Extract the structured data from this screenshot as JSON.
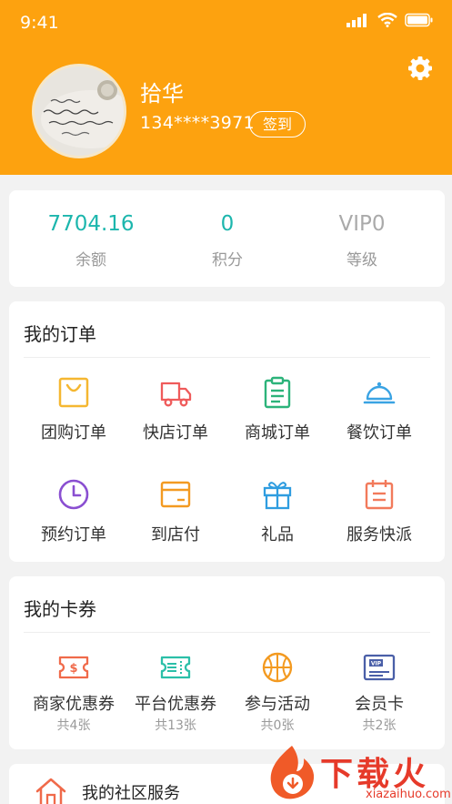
{
  "status_bar": {
    "time": "9:41"
  },
  "profile": {
    "name": "拾华",
    "phone": "134****3971",
    "checkin_label": "签到"
  },
  "stats": [
    {
      "value": "7704.16",
      "label": "余额",
      "color": "#1cb6ad"
    },
    {
      "value": "0",
      "label": "积分",
      "color": "#1cb6ad"
    },
    {
      "value": "VIP0",
      "label": "等级",
      "color": "#aaaaaa"
    }
  ],
  "orders": {
    "title": "我的订单",
    "items": [
      {
        "label": "团购订单",
        "icon": "shopping-bag-icon",
        "color": "#f5b731"
      },
      {
        "label": "快店订单",
        "icon": "truck-icon",
        "color": "#ef5b5b"
      },
      {
        "label": "商城订单",
        "icon": "clipboard-icon",
        "color": "#2cb37a"
      },
      {
        "label": "餐饮订单",
        "icon": "food-cloche-icon",
        "color": "#3aa3e3"
      },
      {
        "label": "预约订单",
        "icon": "clock-icon",
        "color": "#8a4fd1"
      },
      {
        "label": "到店付",
        "icon": "card-icon",
        "color": "#f39a21"
      },
      {
        "label": "礼品",
        "icon": "gift-icon",
        "color": "#2f9de0"
      },
      {
        "label": "服务快派",
        "icon": "calendar-icon",
        "color": "#f27a5b"
      }
    ]
  },
  "coupons": {
    "title": "我的卡券",
    "items": [
      {
        "label": "商家优惠券",
        "prefix": "共",
        "count": "4",
        "suffix": "张",
        "icon": "merchant-coupon-icon",
        "color": "#f06a4a"
      },
      {
        "label": "平台优惠券",
        "prefix": "共",
        "count": "13",
        "suffix": "张",
        "icon": "platform-coupon-icon",
        "color": "#2bbfa8"
      },
      {
        "label": "参与活动",
        "prefix": "共",
        "count": "0",
        "suffix": "张",
        "icon": "basketball-icon",
        "color": "#f39a21"
      },
      {
        "label": "会员卡",
        "prefix": "共",
        "count": "2",
        "suffix": "张",
        "icon": "vip-card-icon",
        "color": "#4a5fa8",
        "icon_text": "VIP"
      }
    ]
  },
  "community": {
    "label": "我的社区服务",
    "icon": "house-icon",
    "color": "#f06a4a"
  },
  "watermark": {
    "text": "下载火",
    "url": "xiazaihuo.com"
  }
}
